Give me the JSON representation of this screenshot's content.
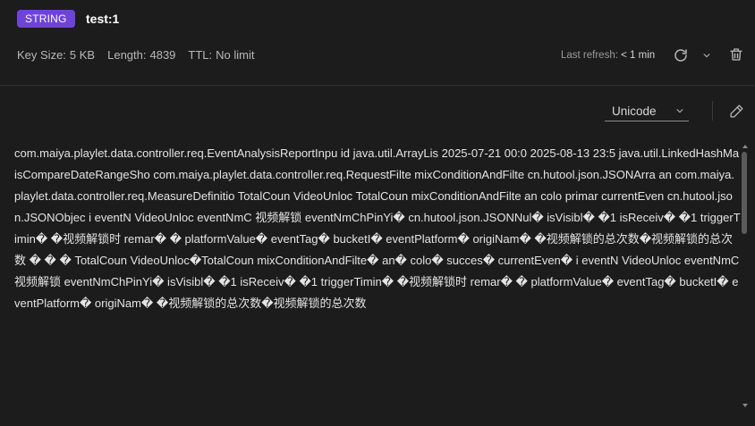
{
  "header": {
    "type_badge": "STRING",
    "key_name": "test:1"
  },
  "meta": {
    "key_size_label": "Key Size:",
    "key_size_value": "5 KB",
    "length_label": "Length:",
    "length_value": "4839",
    "ttl_label": "TTL:",
    "ttl_value": "No limit"
  },
  "refresh": {
    "label": "Last refresh:",
    "value": "< 1 min"
  },
  "toolbar": {
    "encoding_value": "Unicode"
  },
  "icons": {
    "refresh": "refresh-icon",
    "chevron": "chevron-down-icon",
    "delete": "trash-icon",
    "edit": "pencil-icon"
  },
  "colors": {
    "badge": "#6e43d8",
    "background": "#1c1c1c"
  },
  "value": {
    "text": " com.maiya.playlet.data.controller.req.EventAnalysisReportInpu  id        java.util.ArrayLis                  2025-07-21 00:0  2025-08-13 23:5          java.util.LinkedHashMa   isCompareDateRangeSho      com.maiya.playlet.data.controller.req.RequestFilte              mixConditionAndFilte     cn.hutool.json.JSONArra        an              com.maiya.playlet.data.controller.req.MeasureDefinitio  TotalCoun       VideoUnloc  TotalCoun              mixConditionAndFilte           an        colo    primar  currentEven      cn.hutool.json.JSONObjec    i        eventN   VideoUnloc    eventNmC     视频解锁  eventNmChPinYi�    cn.hutool.json.JSONNul�  isVisibl�  �1  isReceiv�  �1  triggerTimin�  �视频解锁时  remar�  �  platformValue�      eventTag�        bucketI�      eventPlatform�        origiNam�  �视频解锁的总次数�视频解锁的总次数 �      �          �       TotalCoun       VideoUnloc�TotalCoun              mixConditionAndFilte�            an�       colo�  succes� currentEven�     i        eventN   VideoUnloc    eventNmC     视频解锁  eventNmChPinYi�       isVisibl�  �1  isReceiv�  �1  triggerTimin�  �视频解锁时  remar�  �  platformValue�       eventTag�        bucketI�      eventPlatform�        origiNam�  �视频解锁的总次数�视频解锁的总次数"
  }
}
